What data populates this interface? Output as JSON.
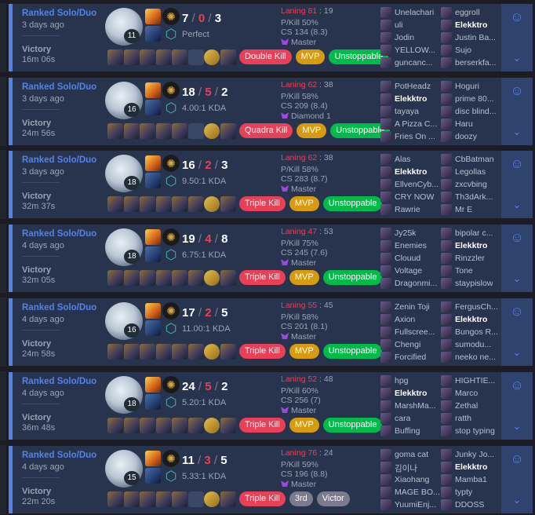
{
  "colors": {
    "accent": "#5383e8",
    "win_bg": "#28344e",
    "kill_red": "#e84057",
    "mvp": "#d89a0e",
    "unstoppable": "#00bb4a"
  },
  "matches": [
    {
      "queue": "Ranked Solo/Duo",
      "time_ago": "3 days ago",
      "result": "Victory",
      "duration": "16m 06s",
      "champion_level": "11",
      "kills": "7",
      "deaths": "0",
      "assists": "3",
      "kda_text": "Perfect",
      "tags": [
        "Double Kill",
        "MVP",
        "Unstoppable"
      ],
      "laning_label": "Laning 81",
      "laning_value": "19",
      "p_kill": "P/Kill 50%",
      "cs": "CS 134 (8.3)",
      "tier": "Master",
      "blue": [
        "Unelachari",
        "uli",
        "Jodin",
        "YELLOW...",
        "guncanc..."
      ],
      "red": [
        "eggroll",
        "Elekktro",
        "Justin Ba...",
        "Sujo",
        "berserkfa..."
      ],
      "me_side": "red",
      "me_index": 1,
      "empty_items": [
        5,
        6
      ]
    },
    {
      "queue": "Ranked Solo/Duo",
      "time_ago": "3 days ago",
      "result": "Victory",
      "duration": "24m 56s",
      "champion_level": "16",
      "kills": "18",
      "deaths": "5",
      "assists": "2",
      "kda_text": "4.00:1 KDA",
      "tags": [
        "Quadra Kill",
        "MVP",
        "Unstoppable"
      ],
      "laning_label": "Laning 62",
      "laning_value": "38",
      "p_kill": "P/Kill 58%",
      "cs": "CS 209 (8.4)",
      "tier": "Diamond 1",
      "blue": [
        "PotHeadz",
        "Elekktro",
        "tayaya",
        "A Pizza C...",
        "Fries On ..."
      ],
      "red": [
        "Hoguri",
        "prime 80...",
        "disc blind...",
        "Haru",
        "doozy"
      ],
      "me_side": "blue",
      "me_index": 1,
      "empty_items": [
        5
      ]
    },
    {
      "queue": "Ranked Solo/Duo",
      "time_ago": "3 days ago",
      "result": "Victory",
      "duration": "32m 37s",
      "champion_level": "18",
      "kills": "16",
      "deaths": "2",
      "assists": "3",
      "kda_text": "9.50:1 KDA",
      "tags": [
        "Triple Kill",
        "MVP",
        "Unstoppable"
      ],
      "laning_label": "Laning 62",
      "laning_value": "38",
      "p_kill": "P/Kill 58%",
      "cs": "CS 283 (8.7)",
      "tier": "Master",
      "blue": [
        "Alas",
        "Elekktro",
        "EllvenCyb...",
        "CRY NOW",
        "Rawrie"
      ],
      "red": [
        "CbBatman",
        "Legollas",
        "zxcvbing",
        "Th3dArk...",
        "Mr E"
      ],
      "me_side": "blue",
      "me_index": 1,
      "empty_items": []
    },
    {
      "queue": "Ranked Solo/Duo",
      "time_ago": "4 days ago",
      "result": "Victory",
      "duration": "32m 05s",
      "champion_level": "18",
      "kills": "19",
      "deaths": "4",
      "assists": "8",
      "kda_text": "6.75:1 KDA",
      "tags": [
        "Triple Kill",
        "MVP",
        "Unstoppable"
      ],
      "laning_label": "Laning 47",
      "laning_value": "53",
      "p_kill": "P/Kill 75%",
      "cs": "CS 245 (7.6)",
      "tier": "Master",
      "blue": [
        "Jy25k",
        "Enemies",
        "Clouud",
        "Voltage",
        "Dragonmi..."
      ],
      "red": [
        "bipolar c...",
        "Elekktro",
        "Rinzzler",
        "Tone",
        "staypislow"
      ],
      "me_side": "red",
      "me_index": 1,
      "empty_items": []
    },
    {
      "queue": "Ranked Solo/Duo",
      "time_ago": "4 days ago",
      "result": "Victory",
      "duration": "24m 58s",
      "champion_level": "16",
      "kills": "17",
      "deaths": "2",
      "assists": "5",
      "kda_text": "11.00:1 KDA",
      "tags": [
        "Triple Kill",
        "MVP",
        "Unstoppable"
      ],
      "laning_label": "Laning 55",
      "laning_value": "45",
      "p_kill": "P/Kill 58%",
      "cs": "CS 201 (8.1)",
      "tier": "Master",
      "blue": [
        "Zenin Toji",
        "Axion",
        "Fullscree...",
        "Chengi",
        "Forcified"
      ],
      "red": [
        "FergusCh...",
        "Elekktro",
        "Bungos R...",
        "sumodu...",
        "neeko ne..."
      ],
      "me_side": "red",
      "me_index": 1,
      "empty_items": []
    },
    {
      "queue": "Ranked Solo/Duo",
      "time_ago": "4 days ago",
      "result": "Victory",
      "duration": "36m 48s",
      "champion_level": "18",
      "kills": "24",
      "deaths": "5",
      "assists": "2",
      "kda_text": "5.20:1 KDA",
      "tags": [
        "Triple Kill",
        "MVP",
        "Unstoppable"
      ],
      "laning_label": "Laning 52",
      "laning_value": "48",
      "p_kill": "P/Kill 60%",
      "cs": "CS 256 (7)",
      "tier": "Master",
      "blue": [
        "hpg",
        "Elekktro",
        "MarshMa...",
        "cara",
        "Buffing"
      ],
      "red": [
        "HIGHTIE...",
        "Marco",
        "Zethal",
        "ratth",
        "stop typing"
      ],
      "me_side": "blue",
      "me_index": 1,
      "empty_items": []
    },
    {
      "queue": "Ranked Solo/Duo",
      "time_ago": "4 days ago",
      "result": "Victory",
      "duration": "22m 20s",
      "champion_level": "15",
      "kills": "11",
      "deaths": "3",
      "assists": "5",
      "kda_text": "5.33:1 KDA",
      "tags": [
        "Triple Kill",
        "3rd",
        "Victor"
      ],
      "laning_label": "Laning 76",
      "laning_value": "24",
      "p_kill": "P/Kill 59%",
      "cs": "CS 196 (8.8)",
      "tier": "Master",
      "blue": [
        "goma cat",
        "김이나",
        "Xiaohang",
        "MAGE BO...",
        "YuumiEnj..."
      ],
      "red": [
        "Junky Jo...",
        "Elekktro",
        "Mamba1",
        "typty",
        "DDOSS"
      ],
      "me_side": "red",
      "me_index": 1,
      "empty_items": [
        5
      ]
    }
  ],
  "icons": {
    "spell_1": "flash-icon",
    "spell_2": "secondary-spell-icon",
    "rune_1": "keystone-rune-icon",
    "rune_2": "secondary-rune-icon",
    "ward": "trinket-ward-icon",
    "side_top": "ai-assistant-icon",
    "side_bottom": "chevron-down-icon"
  }
}
